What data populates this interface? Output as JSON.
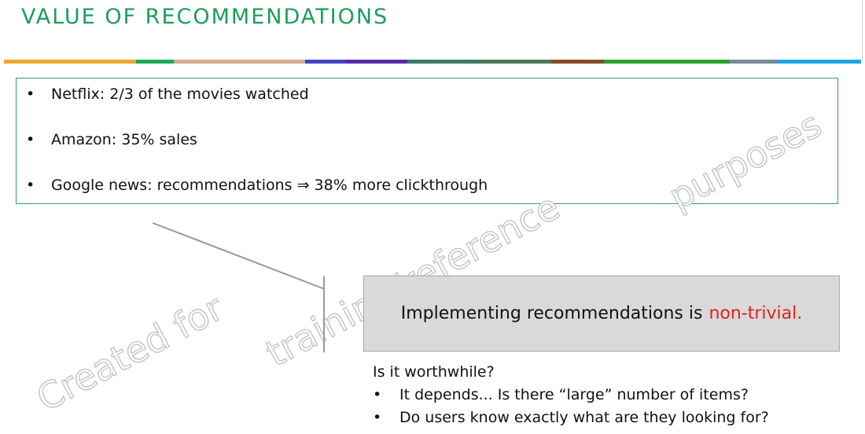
{
  "header": {
    "title": "VALUE OF RECOMMENDATIONS"
  },
  "colors": {
    "title": "#1a9f5a",
    "box_border": "#2aa561",
    "highlight": "#e0221b",
    "callout_fill": "#d9d9d9",
    "stripe": [
      "#f0a830",
      "#1aa85a",
      "#d6ab8c",
      "#4444c8",
      "#5a2aa8",
      "#3a7a6a",
      "#4a7a5a",
      "#8a4a2a",
      "#2ca02c",
      "#7a8a9a",
      "#1ea6e0"
    ]
  },
  "bullets": [
    {
      "marker": "•",
      "text": "Netflix: 2/3 of the movies watched"
    },
    {
      "marker": "•",
      "text": "Amazon: 35% sales"
    },
    {
      "marker": "•",
      "text": "Google news: recommendations ⇒ 38% more clickthrough"
    }
  ],
  "callout": {
    "text": "Implementing recommendations is",
    "highlight": "non-trivial."
  },
  "followup": {
    "question": "Is it worthwhile?",
    "items": [
      {
        "marker": "•",
        "text": "It depends... Is there “large” number of items?"
      },
      {
        "marker": "•",
        "text": "Do users know exactly what are they looking for?"
      }
    ]
  },
  "watermark": {
    "line1": "Created for",
    "line2": "training/reference",
    "line3": "purposes"
  }
}
